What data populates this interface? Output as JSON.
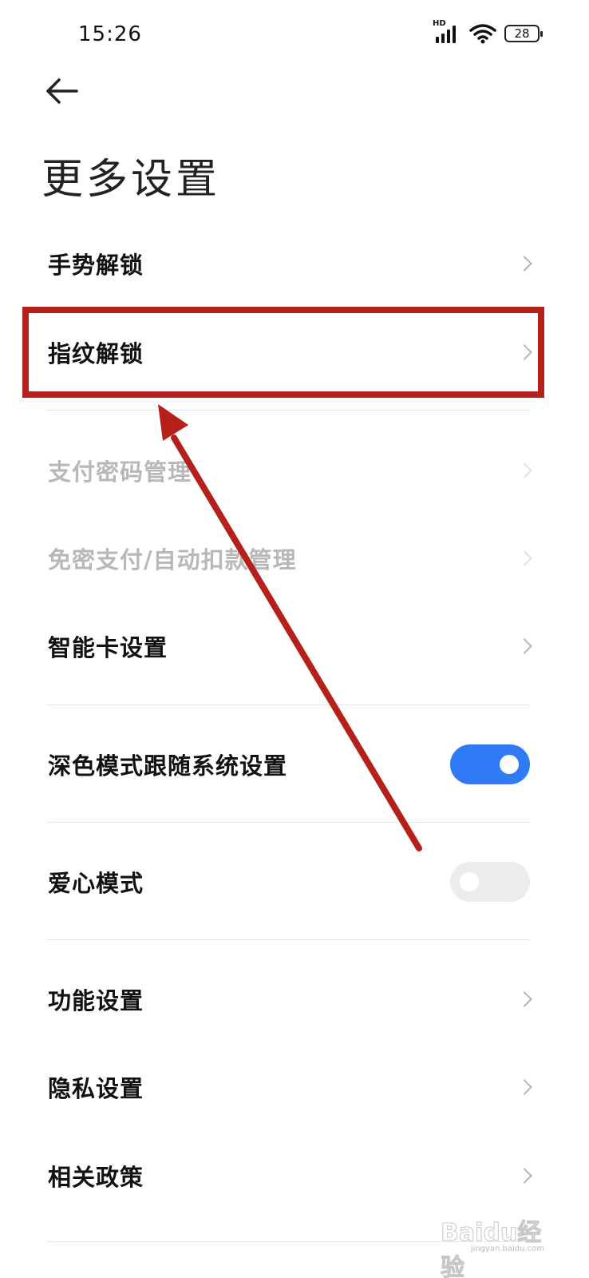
{
  "status_bar": {
    "time": "15:26",
    "network": "HD",
    "battery": "28"
  },
  "page": {
    "title": "更多设置"
  },
  "settings": {
    "gesture_unlock": "手势解锁",
    "fingerprint_unlock": "指纹解锁",
    "payment_password": "支付密码管理",
    "password_free_payment": "免密支付/自动扣款管理",
    "smart_card": "智能卡设置",
    "dark_mode_follow": "深色模式跟随系统设置",
    "love_mode": "爱心模式",
    "feature_settings": "功能设置",
    "privacy_settings": "隐私设置",
    "related_policies": "相关政策"
  },
  "toggles": {
    "dark_mode_follow": true,
    "love_mode": false
  },
  "colors": {
    "toggle_on": "#2f7bf5",
    "toggle_off": "#ececec",
    "annotation": "#b5201b"
  },
  "watermark": {
    "brand": "Baidu经验",
    "url": "jingyan.baidu.com"
  }
}
